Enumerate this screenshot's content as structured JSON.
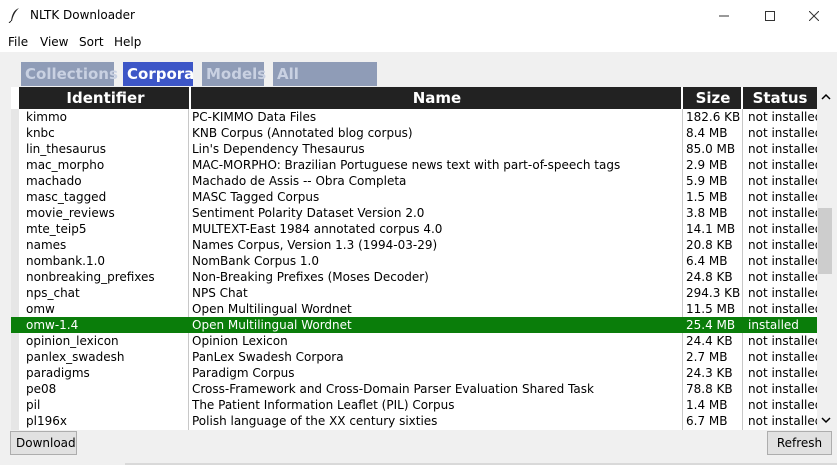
{
  "window": {
    "title": "NLTK Downloader",
    "app_icon": "feather-icon",
    "controls": [
      "minimize-icon",
      "maximize-icon",
      "close-icon"
    ]
  },
  "menu": [
    "File",
    "View",
    "Sort",
    "Help"
  ],
  "tabs": [
    {
      "label": "Collections",
      "active": false
    },
    {
      "label": "Corpora",
      "active": true
    },
    {
      "label": "Models",
      "active": false
    },
    {
      "label": "All Packages",
      "active": false
    }
  ],
  "table": {
    "columns": [
      "Identifier",
      "Name",
      "Size",
      "Status"
    ],
    "rows": [
      {
        "id": "kimmo",
        "name": "PC-KIMMO Data Files",
        "size": "182.6 KB",
        "status": "not installed"
      },
      {
        "id": "knbc",
        "name": "KNB Corpus (Annotated blog corpus)",
        "size": "8.4 MB",
        "status": "not installed"
      },
      {
        "id": "lin_thesaurus",
        "name": "Lin's Dependency Thesaurus",
        "size": "85.0 MB",
        "status": "not installed"
      },
      {
        "id": "mac_morpho",
        "name": "MAC-MORPHO: Brazilian Portuguese news text with part-of-speech tags",
        "size": "2.9 MB",
        "status": "not installed"
      },
      {
        "id": "machado",
        "name": "Machado de Assis -- Obra Completa",
        "size": "5.9 MB",
        "status": "not installed"
      },
      {
        "id": "masc_tagged",
        "name": "MASC Tagged Corpus",
        "size": "1.5 MB",
        "status": "not installed"
      },
      {
        "id": "movie_reviews",
        "name": "Sentiment Polarity Dataset Version 2.0",
        "size": "3.8 MB",
        "status": "not installed"
      },
      {
        "id": "mte_teip5",
        "name": "MULTEXT-East 1984 annotated corpus 4.0",
        "size": "14.1 MB",
        "status": "not installed"
      },
      {
        "id": "names",
        "name": "Names Corpus, Version 1.3 (1994-03-29)",
        "size": "20.8 KB",
        "status": "not installed"
      },
      {
        "id": "nombank.1.0",
        "name": "NomBank Corpus 1.0",
        "size": "6.4 MB",
        "status": "not installed"
      },
      {
        "id": "nonbreaking_prefixes",
        "name": "Non-Breaking Prefixes (Moses Decoder)",
        "size": "24.8 KB",
        "status": "not installed"
      },
      {
        "id": "nps_chat",
        "name": "NPS Chat",
        "size": "294.3 KB",
        "status": "not installed"
      },
      {
        "id": "omw",
        "name": "Open Multilingual Wordnet",
        "size": "11.5 MB",
        "status": "not installed"
      },
      {
        "id": "omw-1.4",
        "name": "Open Multilingual Wordnet",
        "size": "25.4 MB",
        "status": "installed",
        "selected": true
      },
      {
        "id": "opinion_lexicon",
        "name": "Opinion Lexicon",
        "size": "24.4 KB",
        "status": "not installed"
      },
      {
        "id": "panlex_swadesh",
        "name": "PanLex Swadesh Corpora",
        "size": "2.7 MB",
        "status": "not installed"
      },
      {
        "id": "paradigms",
        "name": "Paradigm Corpus",
        "size": "24.3 KB",
        "status": "not installed"
      },
      {
        "id": "pe08",
        "name": "Cross-Framework and Cross-Domain Parser Evaluation Shared Task",
        "size": "78.8 KB",
        "status": "not installed"
      },
      {
        "id": "pil",
        "name": "The Patient Information Leaflet (PIL) Corpus",
        "size": "1.4 MB",
        "status": "not installed"
      },
      {
        "id": "pl196x",
        "name": "Polish language of the XX century sixties",
        "size": "6.7 MB",
        "status": "not installed"
      }
    ]
  },
  "buttons": {
    "download": "Download",
    "refresh": "Refresh"
  },
  "colors": {
    "selected_row": "#0a7d0a",
    "active_tab": "#3d56c7",
    "inactive_tab": "#8f9cb7",
    "header_bg": "#222222"
  }
}
